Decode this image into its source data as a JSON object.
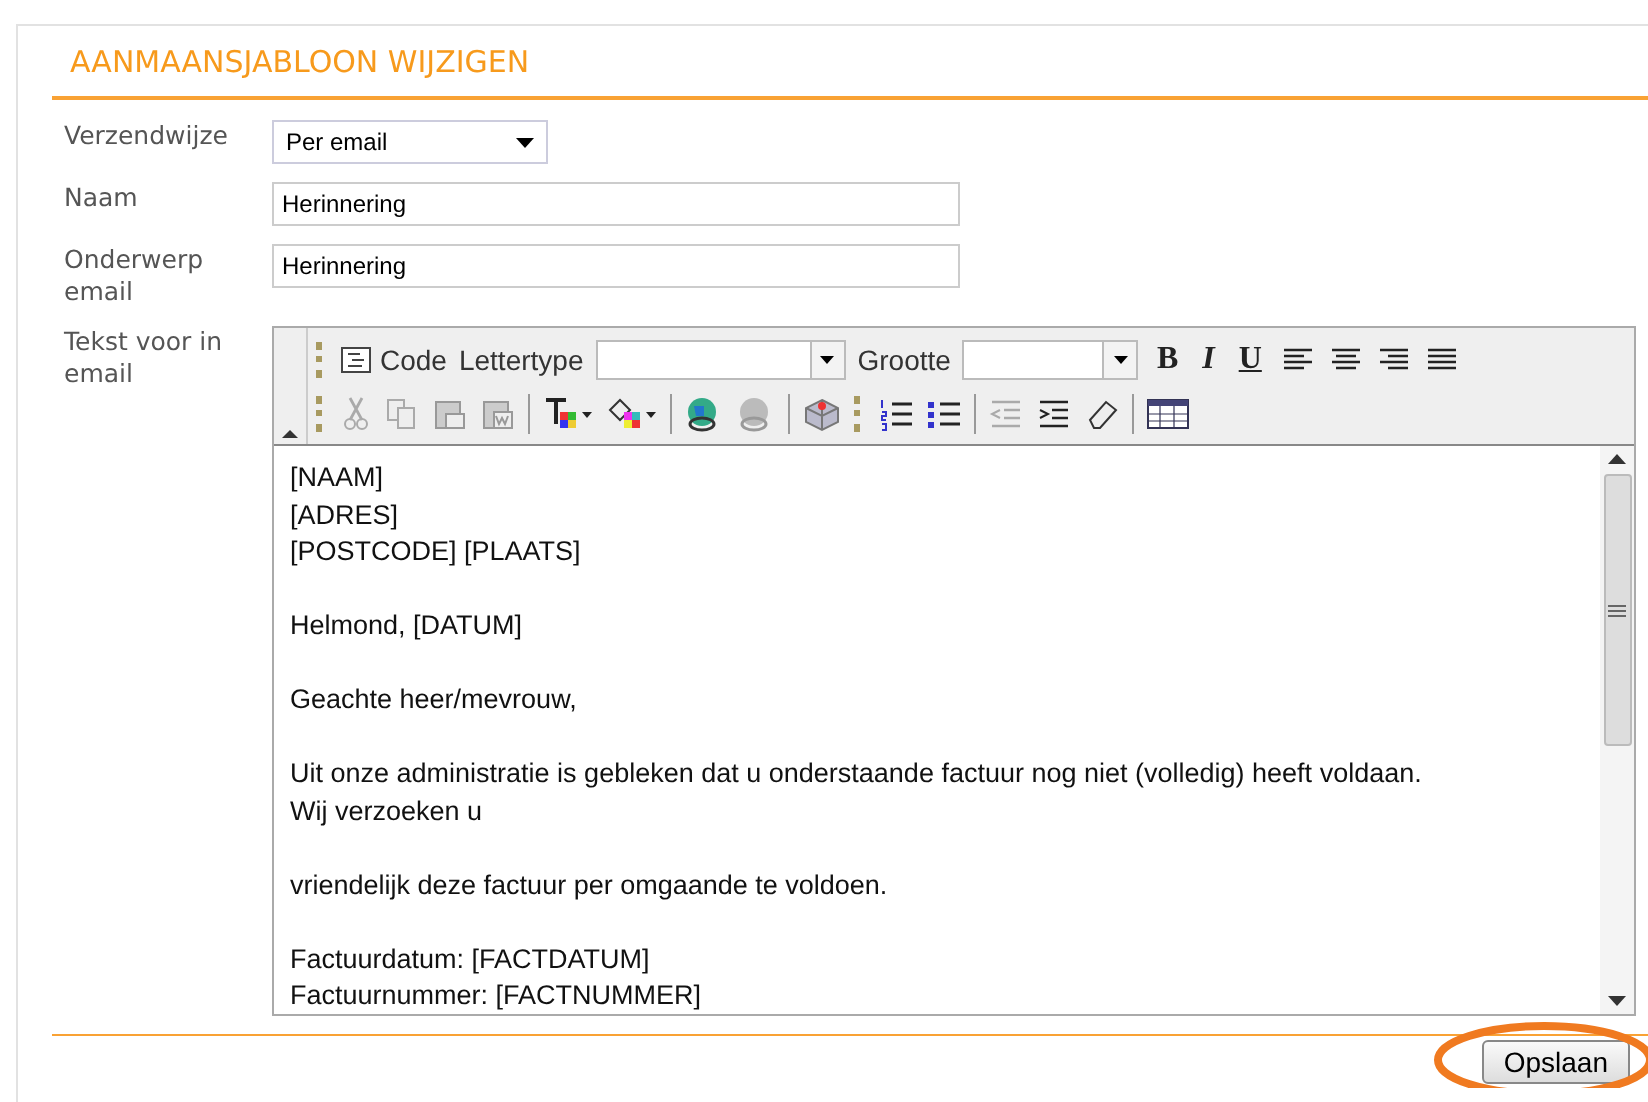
{
  "title": "AANMAANSJABLOON WIJZIGEN",
  "fields": [
    {
      "kind": "select",
      "label": "Verzendwijze",
      "value": "Per email"
    },
    {
      "kind": "text",
      "label": "Naam",
      "value": "Herinnering"
    },
    {
      "kind": "text",
      "label": "Onderwerp email",
      "value": "Herinnering"
    }
  ],
  "editor": {
    "label": "Tekst voor in email",
    "toolbar": {
      "code": "Code",
      "font_label": "Lettertype",
      "size_label": "Grootte",
      "format_buttons": [
        "B",
        "I",
        "U"
      ]
    },
    "blocks": [
      [
        "[NAAM]",
        "[ADRES]",
        "[POSTCODE] [PLAATS]"
      ],
      [
        "Helmond, [DATUM]"
      ],
      [
        "Geachte heer/mevrouw,"
      ],
      [
        "Uit onze administratie is gebleken dat u onderstaande factuur nog niet (volledig) heeft voldaan.",
        "Wij verzoeken u"
      ],
      [
        "vriendelijk deze factuur per omgaande te voldoen."
      ],
      [
        "Factuurdatum: [FACTDATUM]",
        "Factuurnummer: [FACTNUMMER]"
      ]
    ]
  },
  "save_button": "Opslaan"
}
